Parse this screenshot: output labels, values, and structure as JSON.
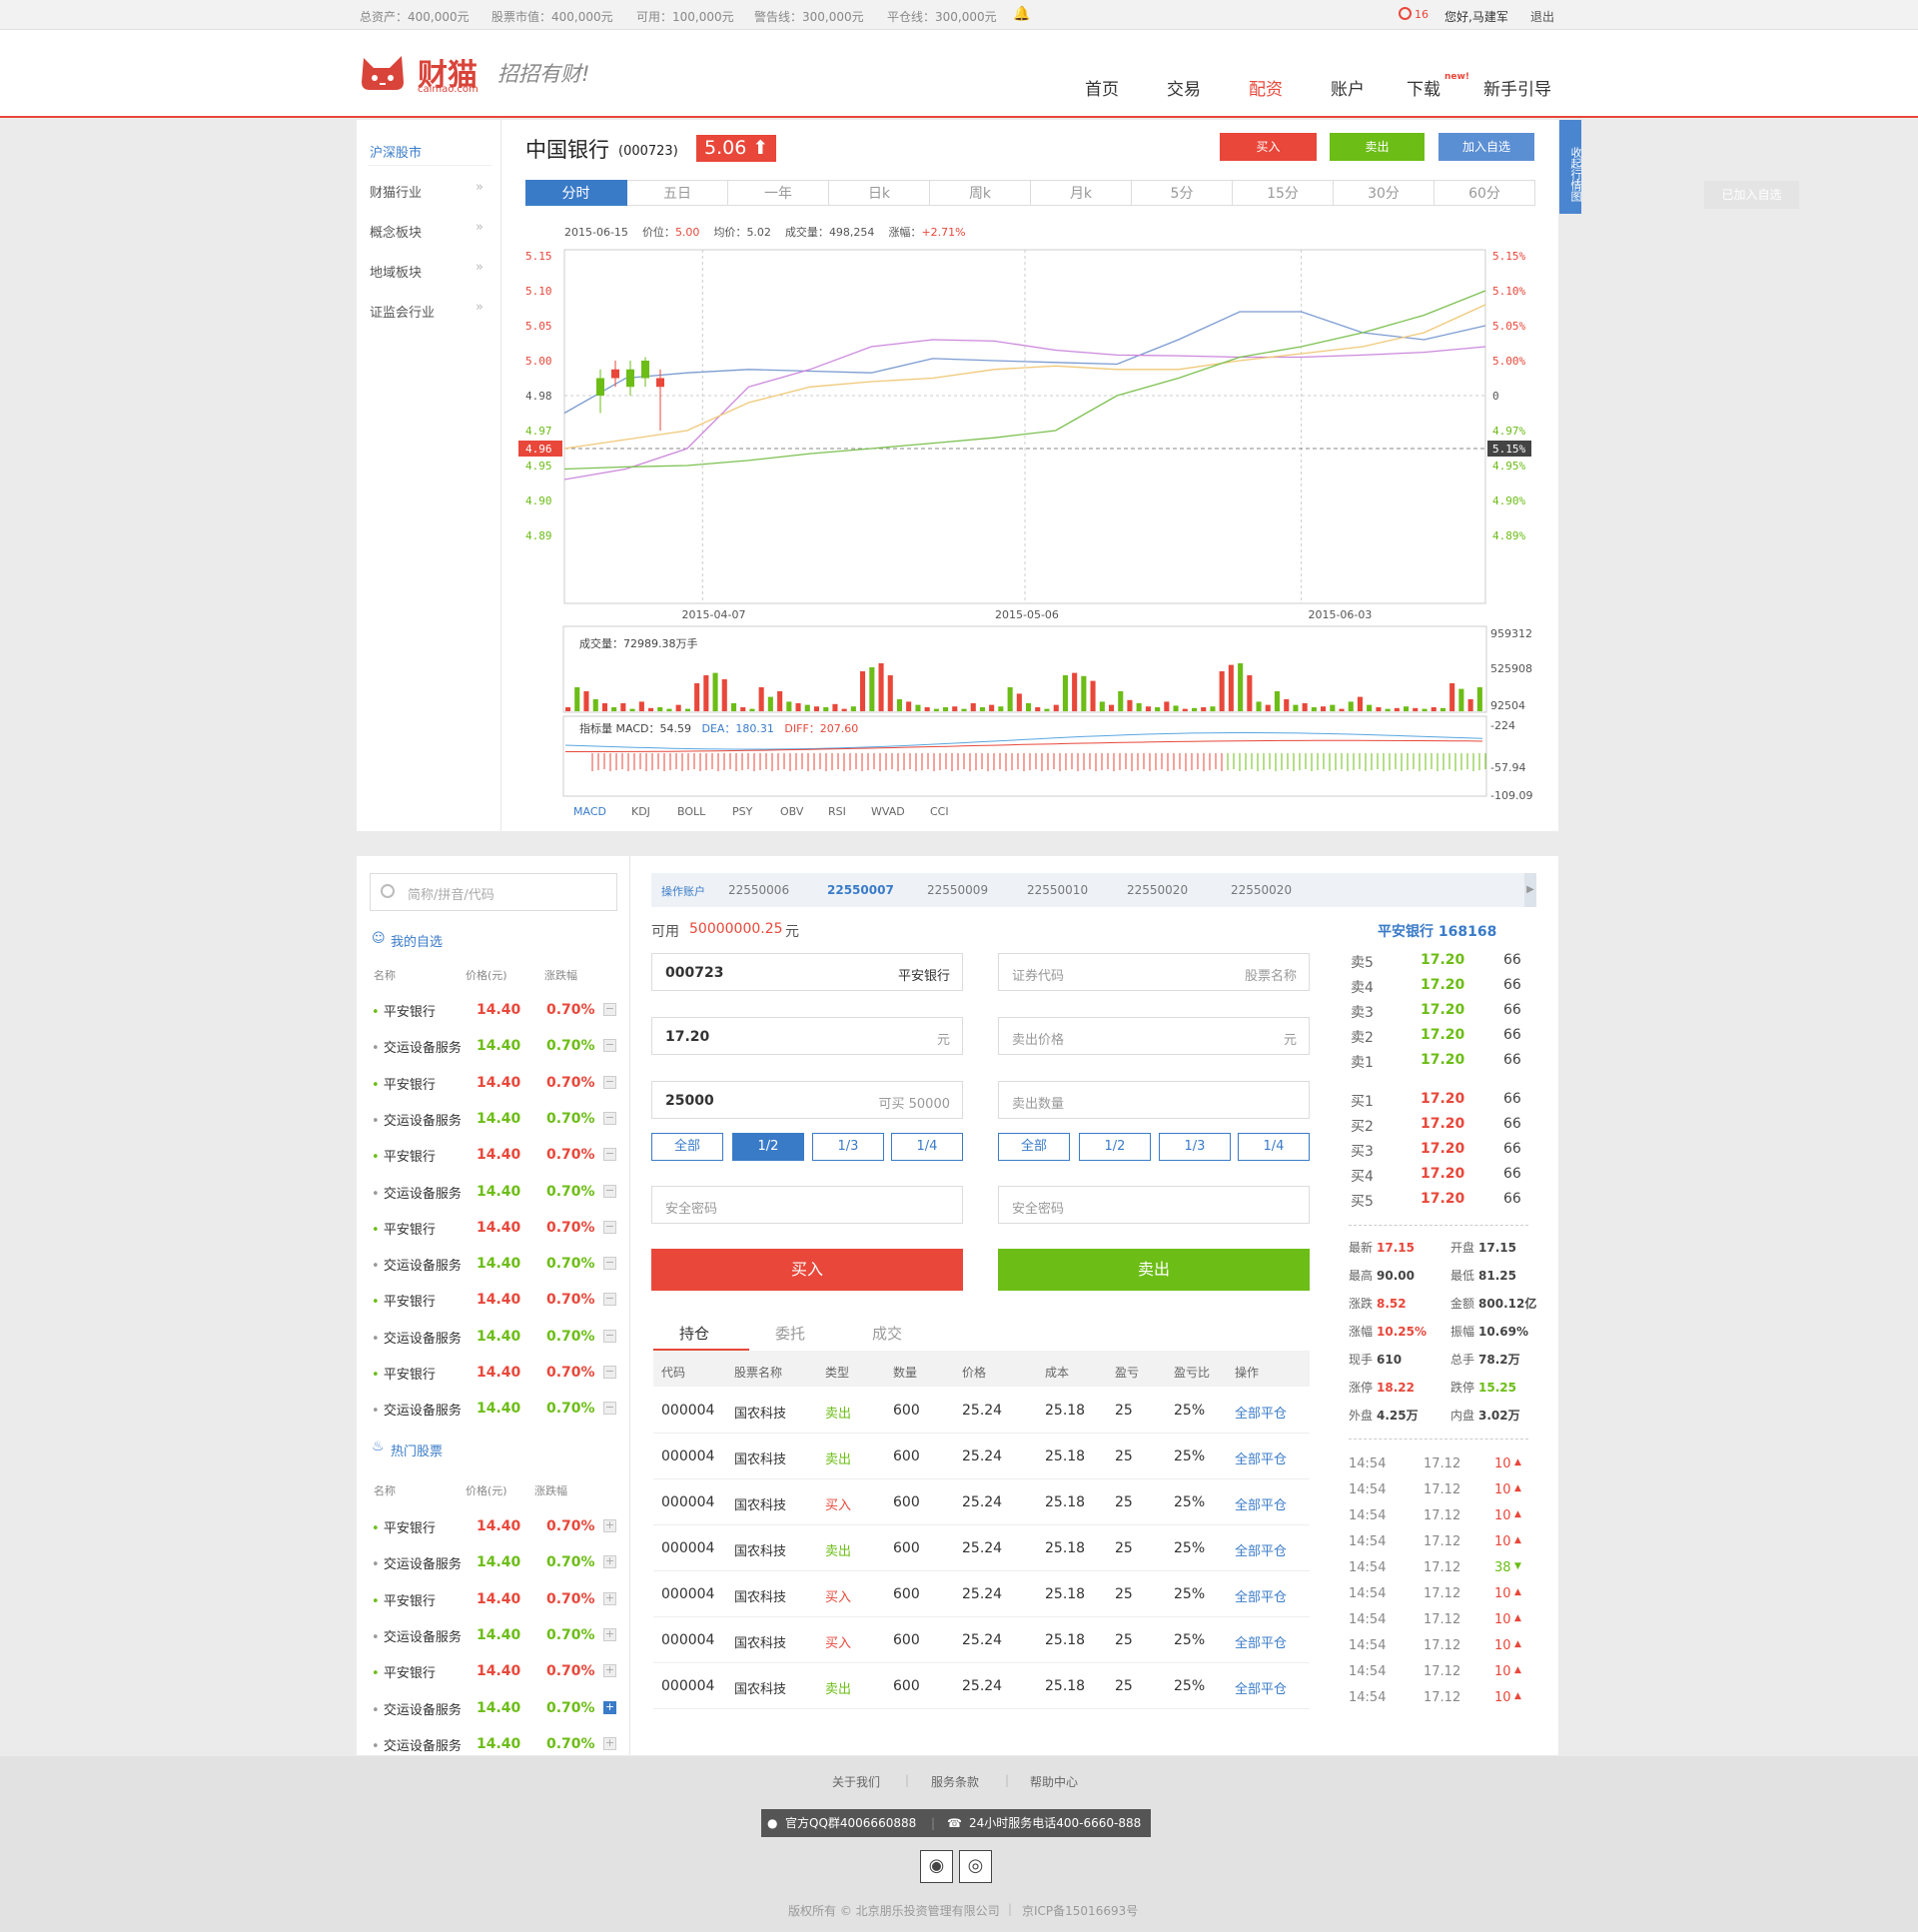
{
  "topbar": {
    "total_assets": "总资产：400,000元",
    "stock_value": "股票市值：400,000元",
    "available": "可用：100,000元",
    "warning_line": "警告线：300,000元",
    "closeout_line": "平仓线：300,000元",
    "alerts": "16",
    "greeting": "您好,马建军",
    "logout": "退出"
  },
  "header": {
    "logo_text": "财猫",
    "logo_domain": "caimao.com",
    "slogan": "招招有财!",
    "nav": [
      "首页",
      "交易",
      "配资",
      "账户",
      "下载",
      "新手引导"
    ],
    "nav_new_badge": "new!",
    "active_nav": "配资"
  },
  "sidebar": {
    "items": [
      "沪深股市",
      "财猫行业",
      "概念板块",
      "地域板块",
      "证监会行业"
    ]
  },
  "stock": {
    "name": "中国银行",
    "code": "(000723)",
    "price": "5.06 ⬆",
    "buy": "买入",
    "sell": "卖出",
    "add_watch": "加入自选",
    "added_watch": "已加入自选",
    "collapse": "收起行情图"
  },
  "chart_tabs": [
    "分时",
    "五日",
    "一年",
    "日k",
    "周k",
    "月k",
    "5分",
    "15分",
    "30分",
    "60分"
  ],
  "chart_info": {
    "date": "2015-06-15",
    "price_label": "价位：",
    "price": "5.00",
    "avg_label": "均价：",
    "avg": "5.02",
    "vol_label": "成交量：",
    "vol": "498,254",
    "chg_label": "涨幅：",
    "chg": "+2.71%"
  },
  "colors": {
    "red": "#e8473a",
    "green": "#6cbd16",
    "blue": "#3a7bc8"
  },
  "chart_data": [
    {
      "type": "line",
      "y_left_ticks": [
        "5.15",
        "5.10",
        "5.05",
        "5.00",
        "4.98",
        "4.97",
        "4.96",
        "4.95",
        "4.90",
        "4.89"
      ],
      "y_right_ticks": [
        "5.15%",
        "5.10%",
        "5.05%",
        "5.00%",
        "0",
        "4.97%",
        "5.15%",
        "4.95%",
        "4.90%",
        "4.89%"
      ],
      "x_ticks": [
        "2015-04-07",
        "2015-05-06",
        "2015-06-03"
      ],
      "current_marker_left": "4.96",
      "current_marker_right": "5.15%",
      "series": [
        {
          "color": "#7b9bd1",
          "values": [
            4.975,
            4.99,
            4.993,
            4.995,
            4.994,
            4.993,
            5.003,
            5.0,
            4.999,
            4.998,
            5.03,
            5.07,
            5.07,
            5.04,
            5.03,
            5.05
          ]
        },
        {
          "color": "#cc88dd",
          "values": [
            4.93,
            4.945,
            4.96,
            4.985,
            4.995,
            5.02,
            5.03,
            5.028,
            5.015,
            5.008,
            5.007,
            5.005,
            5.005,
            5.008,
            5.012,
            5.02
          ]
        },
        {
          "color": "#f0c878",
          "values": [
            4.96,
            4.965,
            4.97,
            4.978,
            4.985,
            4.988,
            4.99,
            4.995,
            4.997,
            4.995,
            4.995,
            5.0,
            5.01,
            5.02,
            5.04,
            5.08
          ]
        },
        {
          "color": "#7cc050",
          "values": [
            4.945,
            4.948,
            4.95,
            4.953,
            4.957,
            4.96,
            4.963,
            4.966,
            4.97,
            4.98,
            4.99,
            5.005,
            5.02,
            5.04,
            5.065,
            5.1
          ]
        }
      ],
      "candles": [
        {
          "o": 4.98,
          "c": 4.99,
          "h": 4.995,
          "l": 4.975,
          "up": true
        },
        {
          "o": 4.995,
          "c": 4.99,
          "h": 5.0,
          "l": 4.985,
          "up": false
        },
        {
          "o": 4.985,
          "c": 4.995,
          "h": 5.0,
          "l": 4.98,
          "up": true
        },
        {
          "o": 4.99,
          "c": 5.0,
          "h": 5.005,
          "l": 4.985,
          "up": true
        },
        {
          "o": 4.99,
          "c": 4.985,
          "h": 4.995,
          "l": 4.97,
          "up": false
        }
      ]
    },
    {
      "type": "bar",
      "title": "成交量：72989.38万手",
      "y_ticks": [
        "959312",
        "525908",
        "92504"
      ],
      "values": [
        5,
        30,
        25,
        15,
        10,
        5,
        10,
        3,
        12,
        4,
        5,
        3,
        8,
        3,
        35,
        45,
        48,
        40,
        10,
        5,
        3,
        30,
        18,
        25,
        12,
        10,
        8,
        6,
        5,
        9,
        3,
        6,
        50,
        55,
        60,
        45,
        15,
        12,
        8,
        5,
        3,
        5,
        6,
        3,
        10,
        5,
        8,
        6,
        30,
        22,
        10,
        5,
        3,
        8,
        45,
        48,
        44,
        38,
        12,
        8,
        25,
        14,
        10,
        6,
        5,
        12,
        7,
        3,
        4,
        5,
        6,
        50,
        58,
        60,
        45,
        12,
        8,
        25,
        15,
        8,
        10,
        5,
        6,
        8,
        3,
        12,
        18,
        8,
        5,
        3,
        4,
        6,
        4,
        3,
        5,
        4,
        35,
        28,
        15,
        30
      ],
      "ups": [
        1,
        0,
        1,
        0,
        1,
        0,
        1,
        0,
        1,
        1,
        0,
        0,
        1,
        0,
        1,
        1,
        0,
        1,
        0,
        1,
        0,
        1,
        0,
        1,
        0,
        1,
        0,
        1,
        0,
        1,
        1,
        0,
        1,
        0,
        1,
        1,
        0,
        1,
        0,
        1,
        0,
        0,
        1,
        0,
        1,
        0,
        1,
        0,
        0,
        1,
        0,
        1,
        0,
        1,
        0,
        1,
        0,
        1,
        0,
        1,
        0,
        1,
        0,
        1,
        0,
        1,
        0,
        1,
        0,
        1,
        0,
        1,
        1,
        0,
        1,
        0,
        1,
        0,
        1,
        0,
        1,
        0,
        1,
        0,
        1,
        0,
        1,
        0,
        1,
        0,
        1,
        0,
        1,
        0,
        1,
        0,
        1,
        0,
        1,
        0
      ]
    },
    {
      "type": "line",
      "title": "指标量 MACD：54.59  DEA：180.31  DIFF：207.60",
      "y_ticks": [
        "-224",
        "-57.94",
        "-109.09"
      ],
      "macd_label": "指标量 MACD：54.59",
      "dea_label": "DEA：180.31",
      "diff_label": "DIFF：207.60"
    }
  ],
  "indicators": [
    "MACD",
    "KDJ",
    "BOLL",
    "PSY",
    "OBV",
    "RSI",
    "WVAD",
    "CCI"
  ],
  "watchlist": {
    "search_placeholder": "简称/拼音/代码",
    "my_title": "我的自选",
    "hot_title": "热门股票",
    "headers": [
      "名称",
      "价格(元)",
      "涨跌幅"
    ],
    "my": [
      {
        "name": "平安银行",
        "price": "14.40",
        "pct": "0.70%",
        "up": true
      },
      {
        "name": "交运设备服务",
        "price": "14.40",
        "pct": "0.70%",
        "up": false
      },
      {
        "name": "平安银行",
        "price": "14.40",
        "pct": "0.70%",
        "up": true
      },
      {
        "name": "交运设备服务",
        "price": "14.40",
        "pct": "0.70%",
        "up": false
      },
      {
        "name": "平安银行",
        "price": "14.40",
        "pct": "0.70%",
        "up": true
      },
      {
        "name": "交运设备服务",
        "price": "14.40",
        "pct": "0.70%",
        "up": false
      },
      {
        "name": "平安银行",
        "price": "14.40",
        "pct": "0.70%",
        "up": true
      },
      {
        "name": "交运设备服务",
        "price": "14.40",
        "pct": "0.70%",
        "up": false
      },
      {
        "name": "平安银行",
        "price": "14.40",
        "pct": "0.70%",
        "up": true
      },
      {
        "name": "交运设备服务",
        "price": "14.40",
        "pct": "0.70%",
        "up": false
      },
      {
        "name": "平安银行",
        "price": "14.40",
        "pct": "0.70%",
        "up": true
      },
      {
        "name": "交运设备服务",
        "price": "14.40",
        "pct": "0.70%",
        "up": false
      }
    ],
    "hot": [
      {
        "name": "平安银行",
        "price": "14.40",
        "pct": "0.70%",
        "up": true
      },
      {
        "name": "交运设备服务",
        "price": "14.40",
        "pct": "0.70%",
        "up": false
      },
      {
        "name": "平安银行",
        "price": "14.40",
        "pct": "0.70%",
        "up": true
      },
      {
        "name": "交运设备服务",
        "price": "14.40",
        "pct": "0.70%",
        "up": false
      },
      {
        "name": "平安银行",
        "price": "14.40",
        "pct": "0.70%",
        "up": true
      },
      {
        "name": "交运设备服务",
        "price": "14.40",
        "pct": "0.70%",
        "up": false
      },
      {
        "name": "交运设备服务",
        "price": "14.40",
        "pct": "0.70%",
        "up": false
      }
    ]
  },
  "trade": {
    "account_label": "操作账户",
    "accounts": [
      "22550006",
      "22550007",
      "22550009",
      "22550010",
      "22550020",
      "22550020"
    ],
    "active_account": "22550007",
    "available_label": "可用",
    "available_amount": "50000000.25",
    "yuan": "元",
    "buy_code": "000723",
    "buy_name": "平安银行",
    "buy_price": "17.20",
    "buy_qty": "25000",
    "can_buy": "可买 50000",
    "sell_code_ph": "证券代码",
    "sell_name_ph": "股票名称",
    "sell_price_ph": "卖出价格",
    "sell_qty_ph": "卖出数量",
    "pwd_ph": "安全密码",
    "fracs": [
      "全部",
      "1/2",
      "1/3",
      "1/4"
    ],
    "buy_btn": "买入",
    "sell_btn": "卖出"
  },
  "orderbook": {
    "title": "平安银行 168168",
    "sells": [
      {
        "label": "卖5",
        "price": "17.20",
        "qty": "66"
      },
      {
        "label": "卖4",
        "price": "17.20",
        "qty": "66"
      },
      {
        "label": "卖3",
        "price": "17.20",
        "qty": "66"
      },
      {
        "label": "卖2",
        "price": "17.20",
        "qty": "66"
      },
      {
        "label": "卖1",
        "price": "17.20",
        "qty": "66"
      }
    ],
    "buys": [
      {
        "label": "买1",
        "price": "17.20",
        "qty": "66"
      },
      {
        "label": "买2",
        "price": "17.20",
        "qty": "66"
      },
      {
        "label": "买3",
        "price": "17.20",
        "qty": "66"
      },
      {
        "label": "买4",
        "price": "17.20",
        "qty": "66"
      },
      {
        "label": "买5",
        "price": "17.20",
        "qty": "66"
      }
    ],
    "quotes": [
      {
        "l": "最新",
        "v": "17.15",
        "c": "red"
      },
      {
        "l": "开盘",
        "v": "17.15",
        "c": "dark"
      },
      {
        "l": "最高",
        "v": "90.00",
        "c": "dark"
      },
      {
        "l": "最低",
        "v": "81.25",
        "c": "dark"
      },
      {
        "l": "涨跌",
        "v": "8.52",
        "c": "red"
      },
      {
        "l": "金额",
        "v": "800.12亿",
        "c": "dark"
      },
      {
        "l": "涨幅",
        "v": "10.25%",
        "c": "red"
      },
      {
        "l": "振幅",
        "v": "10.69%",
        "c": "dark"
      },
      {
        "l": "现手",
        "v": "610",
        "c": "dark"
      },
      {
        "l": "总手",
        "v": "78.2万",
        "c": "dark"
      },
      {
        "l": "涨停",
        "v": "18.22",
        "c": "red"
      },
      {
        "l": "跌停",
        "v": "15.25",
        "c": "green"
      },
      {
        "l": "外盘",
        "v": "4.25万",
        "c": "dark"
      },
      {
        "l": "内盘",
        "v": "3.02万",
        "c": "dark"
      }
    ],
    "ticks": [
      {
        "t": "14:54",
        "p": "17.12",
        "q": "10",
        "up": true
      },
      {
        "t": "14:54",
        "p": "17.12",
        "q": "10",
        "up": true
      },
      {
        "t": "14:54",
        "p": "17.12",
        "q": "10",
        "up": true
      },
      {
        "t": "14:54",
        "p": "17.12",
        "q": "10",
        "up": true
      },
      {
        "t": "14:54",
        "p": "17.12",
        "q": "38",
        "up": false
      },
      {
        "t": "14:54",
        "p": "17.12",
        "q": "10",
        "up": true
      },
      {
        "t": "14:54",
        "p": "17.12",
        "q": "10",
        "up": true
      },
      {
        "t": "14:54",
        "p": "17.12",
        "q": "10",
        "up": true
      },
      {
        "t": "14:54",
        "p": "17.12",
        "q": "10",
        "up": true
      },
      {
        "t": "14:54",
        "p": "17.12",
        "q": "10",
        "up": true
      }
    ]
  },
  "holdings": {
    "tabs": [
      "持仓",
      "委托",
      "成交"
    ],
    "headers": [
      "代码",
      "股票名称",
      "类型",
      "数量",
      "价格",
      "成本",
      "盈亏",
      "盈亏比",
      "操作"
    ],
    "rows": [
      {
        "code": "000004",
        "name": "国农科技",
        "type": "卖出",
        "qty": "600",
        "price": "25.24",
        "cost": "25.18",
        "pl": "25",
        "plr": "25%",
        "op": "全部平仓"
      },
      {
        "code": "000004",
        "name": "国农科技",
        "type": "卖出",
        "qty": "600",
        "price": "25.24",
        "cost": "25.18",
        "pl": "25",
        "plr": "25%",
        "op": "全部平仓"
      },
      {
        "code": "000004",
        "name": "国农科技",
        "type": "买入",
        "qty": "600",
        "price": "25.24",
        "cost": "25.18",
        "pl": "25",
        "plr": "25%",
        "op": "全部平仓"
      },
      {
        "code": "000004",
        "name": "国农科技",
        "type": "卖出",
        "qty": "600",
        "price": "25.24",
        "cost": "25.18",
        "pl": "25",
        "plr": "25%",
        "op": "全部平仓"
      },
      {
        "code": "000004",
        "name": "国农科技",
        "type": "买入",
        "qty": "600",
        "price": "25.24",
        "cost": "25.18",
        "pl": "25",
        "plr": "25%",
        "op": "全部平仓"
      },
      {
        "code": "000004",
        "name": "国农科技",
        "type": "买入",
        "qty": "600",
        "price": "25.24",
        "cost": "25.18",
        "pl": "25",
        "plr": "25%",
        "op": "全部平仓"
      },
      {
        "code": "000004",
        "name": "国农科技",
        "type": "卖出",
        "qty": "600",
        "price": "25.24",
        "cost": "25.18",
        "pl": "25",
        "plr": "25%",
        "op": "全部平仓"
      }
    ]
  },
  "footer": {
    "links": [
      "关于我们",
      "服务条款",
      "帮助中心"
    ],
    "qq": "官方QQ群4006660888",
    "phone": "24小时服务电话400-6660-888",
    "copyright": "版权所有 © 北京朋乐投资管理有限公司",
    "icp": "京ICP备15016693号"
  }
}
